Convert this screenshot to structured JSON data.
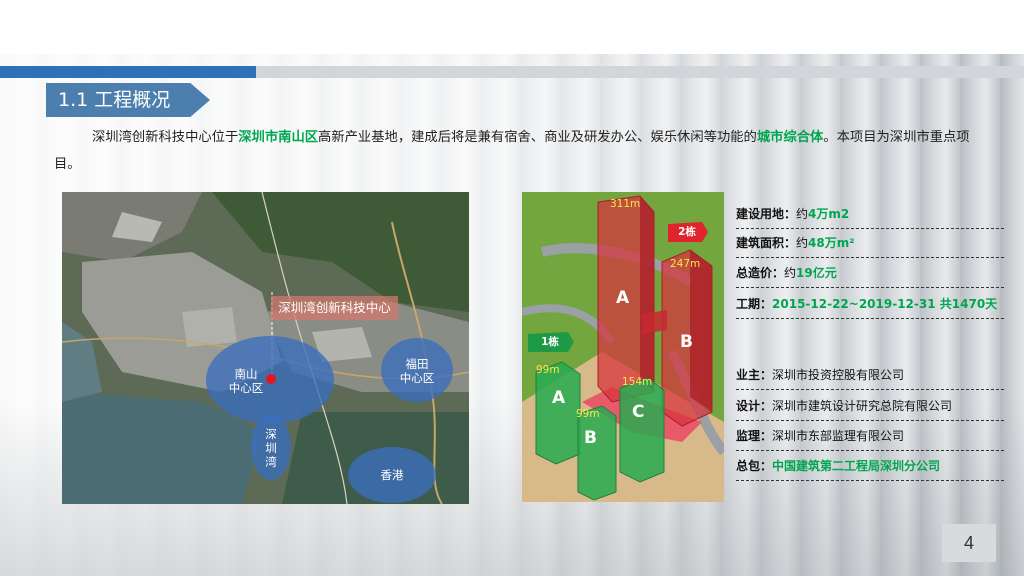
{
  "section": {
    "title": "1.1 工程概况"
  },
  "intro": {
    "p1": "深圳湾创新科技中心位于",
    "h1": "深圳市南山区",
    "p2": "高新产业基地，建成后将是兼有宿舍、商业及研发办公、娱乐休闲等功能的",
    "h2": "城市综合体",
    "p3": "。本项目为深圳市重点项目。"
  },
  "map": {
    "project_label": "深圳湾创新科技中心",
    "zones": {
      "nanshan": "南山\n中心区",
      "futian": "福田\n中心区",
      "shenzhenwan": "深\n圳\n湾",
      "hongkong": "香港"
    }
  },
  "render": {
    "tower_a_big": "A",
    "tower_b_big": "B",
    "tower_a_small": "A",
    "tower_b_small": "B",
    "tower_c_small": "C",
    "h311": "311m",
    "h247": "247m",
    "h99a": "99m",
    "h99b": "99m",
    "h154": "154m",
    "flag2": "2栋",
    "flag1": "1栋"
  },
  "info": {
    "land": {
      "k": "建设用地：",
      "v1": "约",
      "g": "4万m2"
    },
    "area": {
      "k": "建筑面积：",
      "v1": "约",
      "g": "48万m²"
    },
    "cost": {
      "k": "总造价：",
      "v1": "约",
      "g": "19亿元"
    },
    "period": {
      "k": "工期：",
      "g": "2015-12-22~2019-12-31 共1470天"
    },
    "owner": {
      "k": "业主：",
      "v1": "深圳市投资控股有限公司"
    },
    "design": {
      "k": "设计：",
      "v1": "深圳市建筑设计研究总院有限公司"
    },
    "supervise": {
      "k": "监理：",
      "v1": "深圳市东部监理有限公司"
    },
    "contractor": {
      "k": "总包：",
      "g": "中国建筑第二工程局深圳分公司"
    }
  },
  "page": {
    "number": "4"
  },
  "colors": {
    "accent_green": "#00a64f",
    "brand_blue": "#2d72b8",
    "tag_blue": "#4d7fae"
  }
}
